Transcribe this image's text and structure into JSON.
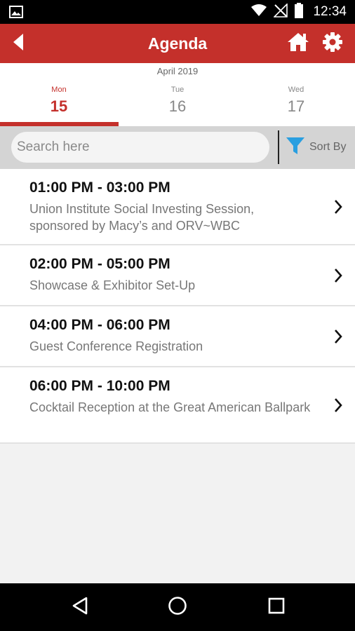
{
  "status_bar": {
    "time": "12:34",
    "icons": [
      "image-icon",
      "wifi-icon",
      "no-signal-icon",
      "battery-icon"
    ]
  },
  "app_bar": {
    "title": "Agenda",
    "background": "#c4302b",
    "icons": [
      "back-arrow-icon",
      "home-icon",
      "gear-icon"
    ]
  },
  "calendar": {
    "month": "April 2019",
    "days": [
      {
        "name": "Mon",
        "number": "15",
        "selected": true
      },
      {
        "name": "Tue",
        "number": "16",
        "selected": false
      },
      {
        "name": "Wed",
        "number": "17",
        "selected": false
      }
    ]
  },
  "search": {
    "placeholder": "Search here",
    "value": "",
    "sort_label": "Sort By",
    "filter_color": "#2a9fe0"
  },
  "sessions": [
    {
      "time": "01:00 PM - 03:00 PM",
      "title": "Union Institute Social Investing Session, sponsored by Macy’s and ORV~WBC"
    },
    {
      "time": "02:00 PM - 05:00 PM",
      "title": "Showcase & Exhibitor Set-Up"
    },
    {
      "time": "04:00 PM - 06:00 PM",
      "title": "Guest Conference Registration"
    },
    {
      "time": "06:00 PM - 10:00 PM",
      "title": "Cocktail Reception at the Great American Ballpark"
    }
  ],
  "nav_bar": {
    "icons": [
      "back-triangle-icon",
      "home-circle-icon",
      "recents-square-icon"
    ]
  }
}
